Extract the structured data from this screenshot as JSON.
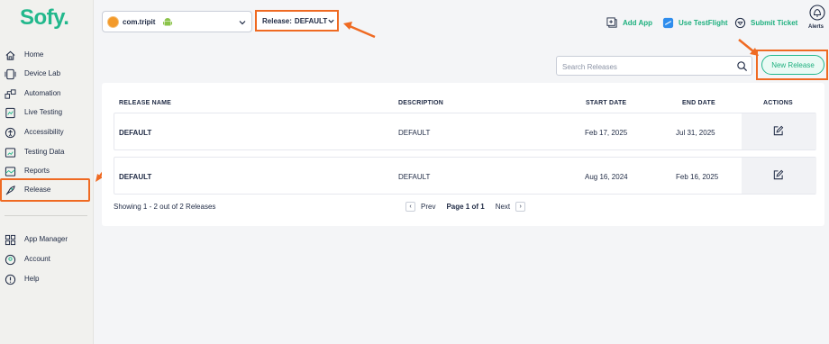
{
  "sidebar": {
    "logo": "Sofy.",
    "items": [
      {
        "label": "Home",
        "icon": "home-icon"
      },
      {
        "label": "Device Lab",
        "icon": "device-icon"
      },
      {
        "label": "Automation",
        "icon": "automation-icon"
      },
      {
        "label": "Live Testing",
        "icon": "live-testing-icon"
      },
      {
        "label": "Accessibility",
        "icon": "accessibility-icon"
      },
      {
        "label": "Testing Data",
        "icon": "testing-data-icon"
      },
      {
        "label": "Reports",
        "icon": "reports-icon"
      },
      {
        "label": "Release",
        "icon": "rocket-icon"
      }
    ],
    "bottom_items": [
      {
        "label": "App Manager",
        "icon": "app-manager-icon"
      },
      {
        "label": "Account",
        "icon": "account-icon"
      },
      {
        "label": "Help",
        "icon": "help-icon"
      }
    ]
  },
  "topbar": {
    "app_selector": {
      "value": "com.tripit",
      "platform_icon": "android-icon"
    },
    "release_selector": {
      "label": "Release:",
      "value": "DEFAULT"
    },
    "actions": [
      {
        "label": "Add App",
        "icon": "add-app-icon"
      },
      {
        "label": "Use TestFlight",
        "icon": "testflight-icon"
      },
      {
        "label": "Submit Ticket",
        "icon": "ticket-icon"
      }
    ],
    "alerts_label": "Alerts"
  },
  "search": {
    "placeholder": "Search Releases",
    "value": ""
  },
  "new_release_label": "New Release",
  "table": {
    "columns": [
      "RELEASE NAME",
      "DESCRIPTION",
      "START DATE",
      "END DATE",
      "ACTIONS"
    ],
    "rows": [
      {
        "name": "DEFAULT",
        "description": "DEFAULT",
        "start": "Feb 17, 2025",
        "end": "Jul 31, 2025"
      },
      {
        "name": "DEFAULT",
        "description": "DEFAULT",
        "start": "Aug 16, 2024",
        "end": "Feb 16, 2025"
      }
    ]
  },
  "pagination": {
    "showing": "Showing 1 - 2 out of 2 Releases",
    "prev": "Prev",
    "page": "Page 1 of 1",
    "next": "Next"
  },
  "colors": {
    "brand": "#22b88c",
    "highlight": "#ef6a22",
    "text": "#1f2a44"
  }
}
